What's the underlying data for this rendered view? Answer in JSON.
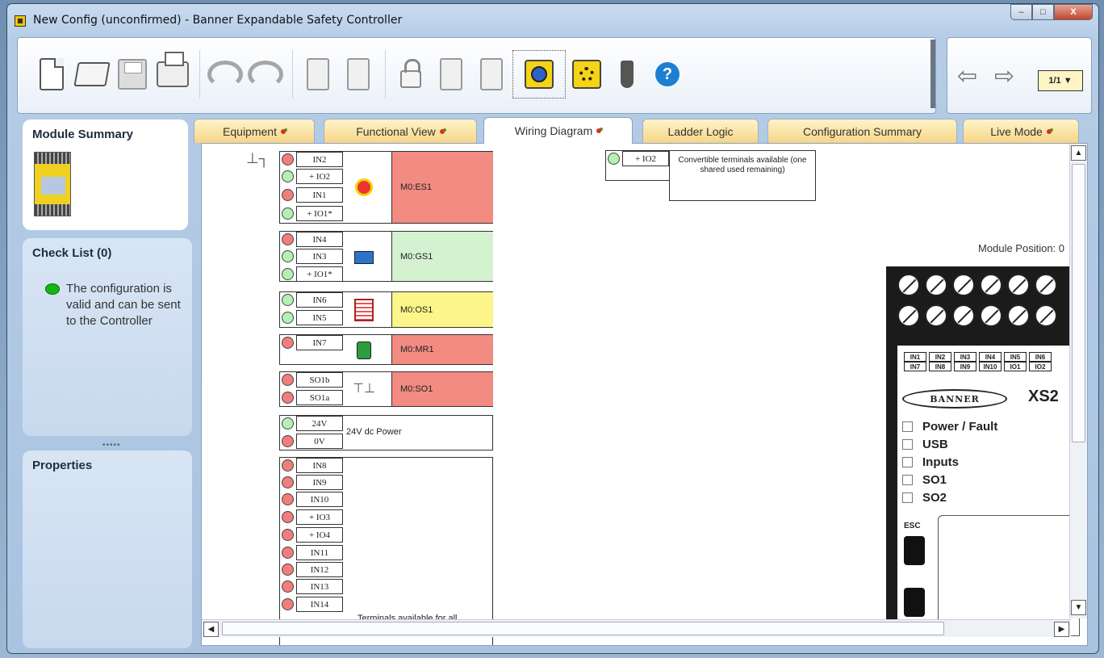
{
  "window": {
    "title": "New Config (unconfirmed) - Banner Expandable Safety Controller",
    "controls": {
      "minimize": "–",
      "maximize": "□",
      "close": "X"
    }
  },
  "toolbar": {
    "buttons": [
      "new-icon",
      "open-icon",
      "save-icon",
      "print-icon",
      "undo-icon",
      "redo-icon",
      "controller-icon",
      "diagnostics-icon",
      "lock-icon",
      "send-icon",
      "receive-icon",
      "wiring-icon",
      "network-icon",
      "plug-icon",
      "help-icon"
    ],
    "help_label": "?"
  },
  "nav": {
    "back": "⇦",
    "forward": "⇨",
    "page": "1/1 ▼"
  },
  "left": {
    "module_summary": "Module Summary",
    "check_list": "Check List (0)",
    "check_message": "The configuration is valid and can be sent to the Controller",
    "splitter": "•••••",
    "properties": "Properties"
  },
  "tabs": [
    {
      "label": "Equipment"
    },
    {
      "label": "Functional View"
    },
    {
      "label": "Wiring Diagram"
    },
    {
      "label": "Ladder Logic"
    },
    {
      "label": "Configuration Summary"
    },
    {
      "label": "Live Mode"
    }
  ],
  "wiring": {
    "es1": {
      "terms": [
        "IN2",
        "+ IO2",
        "IN1",
        "+ IO1*"
      ],
      "name": "M0:ES1"
    },
    "gs1": {
      "terms": [
        "IN4",
        "IN3",
        "+ IO1*"
      ],
      "name": "M0:GS1"
    },
    "os1": {
      "terms": [
        "IN6",
        "IN5"
      ],
      "name": "M0:OS1"
    },
    "mr1": {
      "terms": [
        "IN7"
      ],
      "name": "M0:MR1"
    },
    "so1": {
      "terms": [
        "SO1b",
        "SO1a"
      ],
      "name": "M0:SO1"
    },
    "power": {
      "terms": [
        "24V",
        "0V"
      ],
      "name": "24V dc Power"
    },
    "unused": {
      "terms": [
        "IN8",
        "IN9",
        "IN10",
        "+ IO3",
        "+ IO4",
        "IN11",
        "IN12",
        "IN13",
        "IN14"
      ],
      "note": "Terminals available for all"
    },
    "convertible": {
      "term": "+ IO2",
      "note": "Convertible terminals available (one shared used remaining)"
    }
  },
  "module": {
    "position": "Module Position: 0",
    "pins_top": [
      "IN1",
      "IN2",
      "IN3",
      "IN4",
      "IN5",
      "IN6"
    ],
    "pins_bottom": [
      "IN7",
      "IN8",
      "IN9",
      "IN10",
      "IO1",
      "IO2"
    ],
    "brand": "BANNER",
    "model": "XS2",
    "leds": [
      "Power / Fault",
      "USB",
      "Inputs",
      "SO1",
      "SO2"
    ],
    "esc": "ESC"
  },
  "colors": {
    "red_block": "#f28b82",
    "green_block": "#d4f2d0",
    "yellow_block": "#fbf58a",
    "accent": "#f7d315"
  }
}
